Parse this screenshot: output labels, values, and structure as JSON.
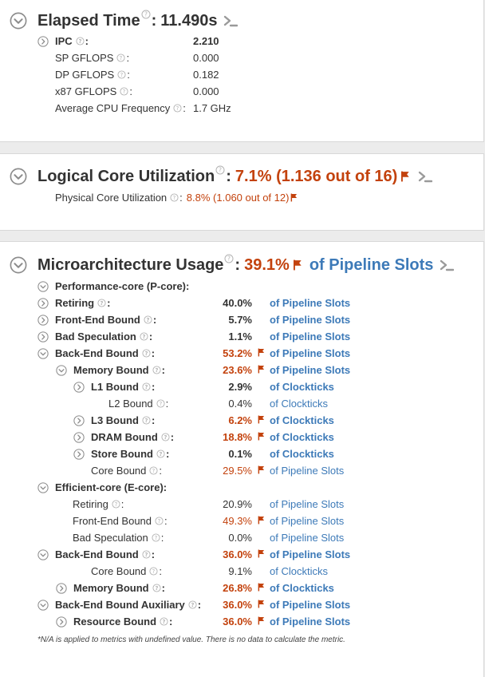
{
  "elapsed": {
    "title": "Elapsed Time",
    "value": "11.490s",
    "metrics": [
      {
        "label": "IPC",
        "value": "2.210"
      },
      {
        "label": "SP GFLOPS",
        "value": "0.000"
      },
      {
        "label": "DP GFLOPS",
        "value": "0.182"
      },
      {
        "label": "x87 GFLOPS",
        "value": "0.000"
      },
      {
        "label": "Average CPU Frequency",
        "value": "1.7 GHz"
      }
    ]
  },
  "logical": {
    "title": "Logical Core Utilization",
    "value": "7.1% (1.136 out of 16)",
    "physical_label": "Physical Core Utilization",
    "physical_value": "8.8% (1.060 out of 12)"
  },
  "micro": {
    "title": "Microarchitecture Usage",
    "value": "39.1%",
    "unit": "of Pipeline Slots",
    "pcore_label": "Performance-core (P-core):",
    "ecore_label": "Efficient-core (E-core):",
    "rows": [
      {
        "label": "Retiring",
        "value": "40.0%",
        "unit": "of Pipeline Slots"
      },
      {
        "label": "Front-End Bound",
        "value": "5.7%",
        "unit": "of Pipeline Slots"
      },
      {
        "label": "Bad Speculation",
        "value": "1.1%",
        "unit": "of Pipeline Slots"
      },
      {
        "label": "Back-End Bound",
        "value": "53.2%",
        "unit": "of Pipeline Slots"
      },
      {
        "label": "Memory Bound",
        "value": "23.6%",
        "unit": "of Pipeline Slots"
      },
      {
        "label": "L1 Bound",
        "value": "2.9%",
        "unit": "of Clockticks"
      },
      {
        "label": "L2 Bound",
        "value": "0.4%",
        "unit": "of Clockticks"
      },
      {
        "label": "L3 Bound",
        "value": "6.2%",
        "unit": "of Clockticks"
      },
      {
        "label": "DRAM Bound",
        "value": "18.8%",
        "unit": "of Clockticks"
      },
      {
        "label": "Store Bound",
        "value": "0.1%",
        "unit": "of Clockticks"
      },
      {
        "label": "Core Bound",
        "value": "29.5%",
        "unit": "of Pipeline Slots"
      },
      {
        "label": "Retiring",
        "value": "20.9%",
        "unit": "of Pipeline Slots"
      },
      {
        "label": "Front-End Bound",
        "value": "49.3%",
        "unit": "of Pipeline Slots"
      },
      {
        "label": "Bad Speculation",
        "value": "0.0%",
        "unit": "of Pipeline Slots"
      },
      {
        "label": "Back-End Bound",
        "value": "36.0%",
        "unit": "of Pipeline Slots"
      },
      {
        "label": "Core Bound",
        "value": "9.1%",
        "unit": "of Clockticks"
      },
      {
        "label": "Memory Bound",
        "value": "26.8%",
        "unit": "of Clockticks"
      },
      {
        "label": "Back-End Bound Auxiliary",
        "value": "36.0%",
        "unit": "of Pipeline Slots"
      },
      {
        "label": "Resource Bound",
        "value": "36.0%",
        "unit": "of Pipeline Slots"
      }
    ],
    "footnote": "*N/A is applied to metrics with undefined value. There is no data to calculate the metric."
  },
  "colors": {
    "accent_red": "#c3420d",
    "link_blue": "#3d7ab8",
    "icon_gray": "#9a9a9a"
  }
}
